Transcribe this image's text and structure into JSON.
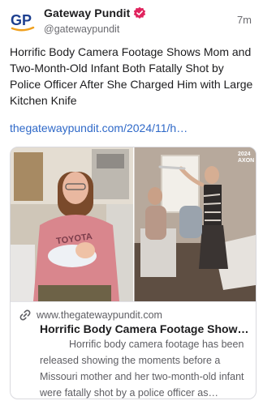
{
  "post": {
    "display_name": "Gateway Pundit",
    "handle": "@gatewaypundit",
    "timestamp": "7m",
    "avatar_icon": "gateway-pundit-logo-icon",
    "verified_icon": "verified-badge-icon",
    "text": "Horrific Body Camera Footage Shows Mom and Two-Month-Old Infant Both Fatally Shot by Police Officer After She Charged Him with Large Kitchen Knife",
    "link": "thegatewaypundit.com/2024/11/h…"
  },
  "card": {
    "link_icon": "link-icon",
    "domain": "www.thegatewaypundit.com",
    "title": "Horrific Body Camera Footage Shows…",
    "description": "Horrific body camera footage has been released showing the moments before a Missouri mother and her two-month-old infant were fatally shot by a police officer as…",
    "media": {
      "left_image_text": "TOYOTA",
      "right_image_watermark_line1": "2024",
      "right_image_watermark_line2": "AXON"
    }
  },
  "colors": {
    "link_blue": "#2f69c8",
    "brand_blue": "#1d3f8f",
    "brand_orange": "#f0a01e",
    "verified_red": "#e0245e"
  }
}
